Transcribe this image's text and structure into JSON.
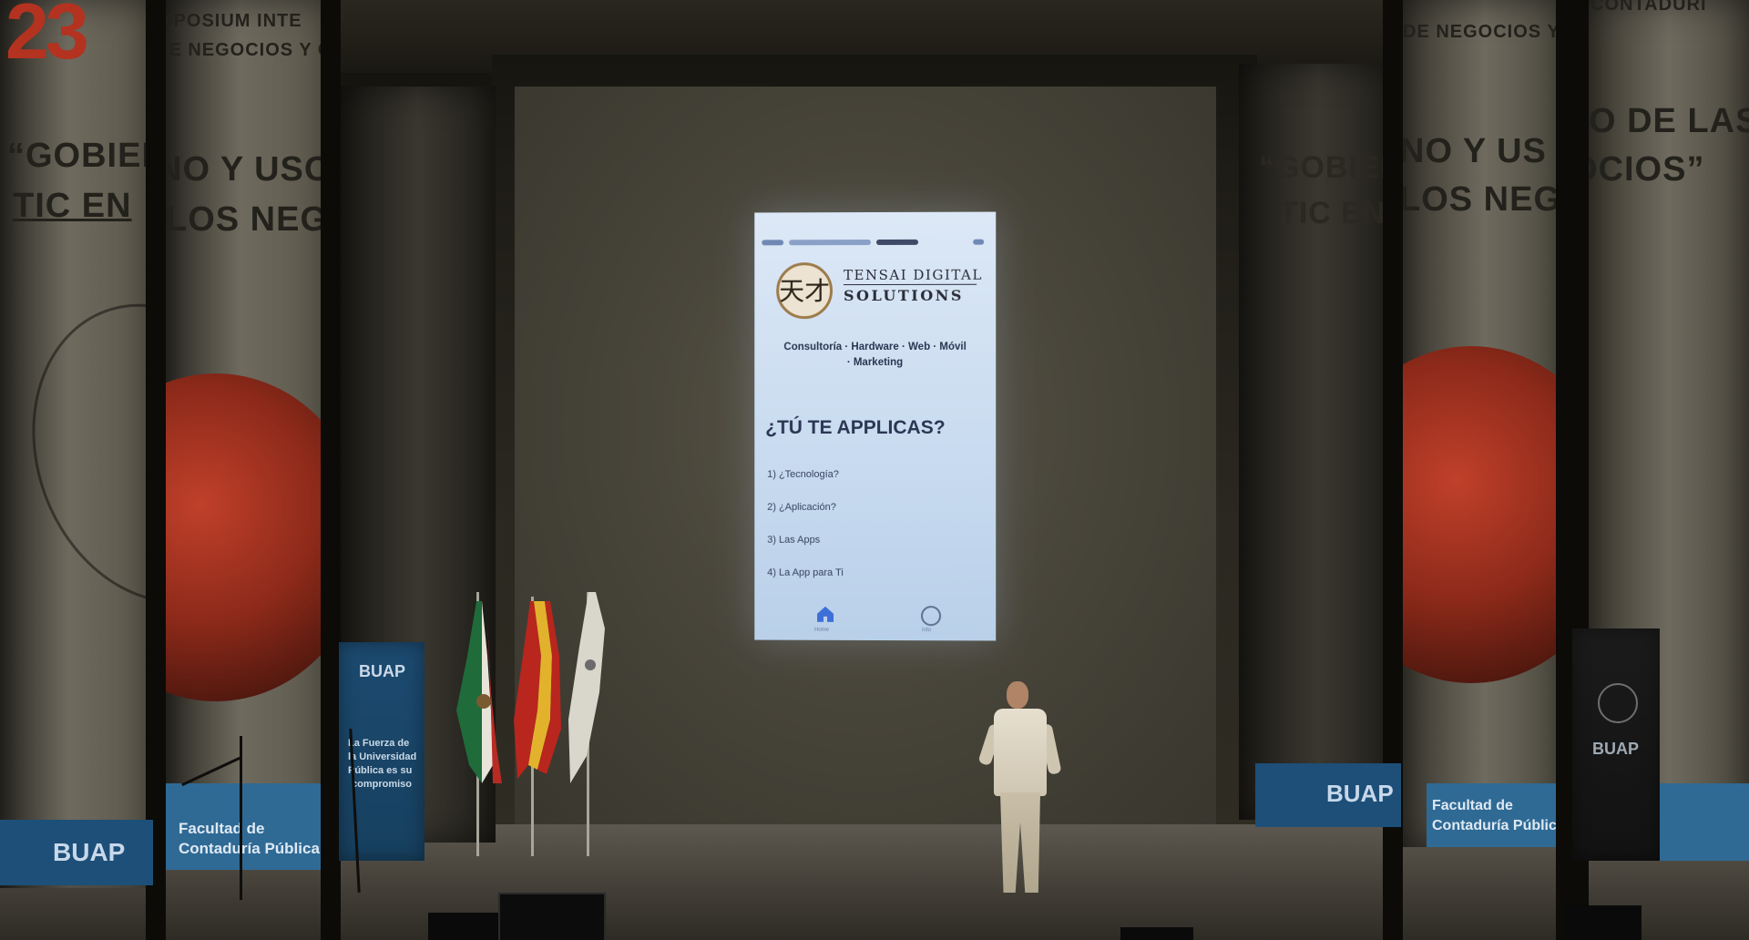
{
  "banner_left": {
    "number": "23",
    "header_line1": "SIMPOSIUM INTE",
    "header_line2": "DE NEGOCIOS Y C",
    "slogan_line1": "“GOBIER",
    "slogan_line1b": "NO Y USO DE LAS",
    "slogan_line2": "TIC  EN",
    "slogan_line2b": "LOS NEGOCIOS”",
    "footer_brand": "BUAP",
    "footer_text_line1": "Facultad de",
    "footer_text_line2": "Contaduría Pública"
  },
  "buap_banner_left": {
    "brand": "BUAP",
    "text_line1": "La Fuerza de",
    "text_line2": "la Universidad",
    "text_line3": "Pública es su",
    "text_line4": "compromiso"
  },
  "banner_right": {
    "header_line1": "DE NEGOCIOS Y",
    "header_line2": "CONTADURÍ",
    "slogan_line1": "“GOBIER",
    "slogan_line1b": "NO Y US",
    "slogan_line1c": "O DE LAS",
    "slogan_line2": "TIC  EN",
    "slogan_line2b": "LOS NEG",
    "slogan_line2c": "OCIOS”",
    "footer_brand": "BUAP",
    "footer_text_line1": "Facultad de",
    "footer_text_line2": "Contaduría Pública"
  },
  "buap_banner_right": {
    "brand": "BUAP"
  },
  "slide": {
    "brand_line1": "TENSAI DIGITAL",
    "brand_line2": "SOLUTIONS",
    "logo_glyph": "天才",
    "services_line1": "Consultoría · Hardware · Web · Móvil",
    "services_line2": "· Marketing",
    "heading": "¿TÚ TE APPLICAS?",
    "items": [
      "1) ¿Tecnología?",
      "2) ¿Aplicación?",
      "3) Las Apps",
      "4) La App para Ti"
    ],
    "tab_home_label": "Home",
    "tab_info_label": "Info"
  },
  "colors": {
    "banner_red": "#b43220",
    "buap_blue": "#1d4f78",
    "slide_bg": "#c7daef",
    "screen": "#48453a"
  },
  "icons": [
    "home-icon",
    "info-icon",
    "tensai-logo-icon"
  ]
}
